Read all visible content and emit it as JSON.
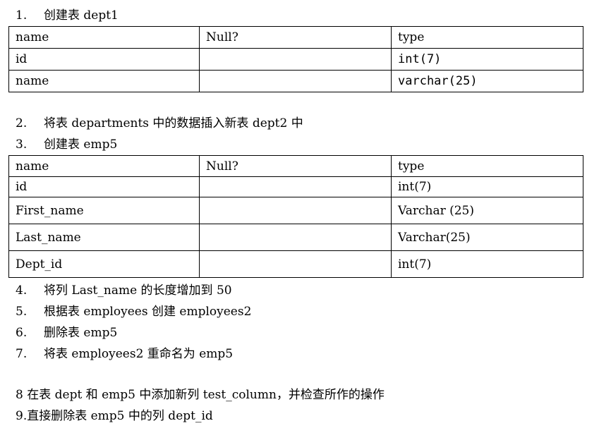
{
  "steps": [
    {
      "num": "1.",
      "text": "创建表 dept1"
    },
    {
      "num": "2.",
      "text": "将表 departments 中的数据插入新表 dept2 中"
    },
    {
      "num": "3.",
      "text": "创建表 emp5"
    },
    {
      "num": "4.",
      "text": "将列 Last_name 的长度增加到 50"
    },
    {
      "num": "5.",
      "text": "根据表 employees 创建 employees2"
    },
    {
      "num": "6.",
      "text": "删除表 emp5"
    },
    {
      "num": "7.",
      "text": "将表 employees2 重命名为 emp5"
    },
    {
      "num": "",
      "text": "8 在表 dept 和 emp5 中添加新列 test_column，并检查所作的操作"
    },
    {
      "num": "",
      "text": "9.直接删除表 emp5 中的列  dept_id"
    }
  ],
  "table_dept1": {
    "headers": [
      "name",
      "Null?",
      "type"
    ],
    "rows": [
      [
        "id",
        "",
        "int(7)"
      ],
      [
        "name",
        "",
        "varchar(25)"
      ]
    ]
  },
  "table_emp5": {
    "headers": [
      "name",
      "Null?",
      "type"
    ],
    "rows": [
      [
        "id",
        "",
        "int(7)"
      ],
      [
        "First_name",
        "",
        "Varchar (25)"
      ],
      [
        "Last_name",
        "",
        "Varchar(25)"
      ],
      [
        "Dept_id",
        "",
        "int(7)"
      ]
    ]
  }
}
